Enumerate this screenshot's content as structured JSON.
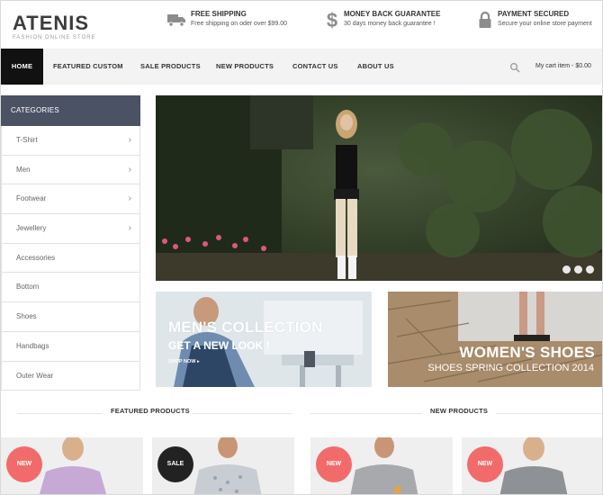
{
  "brand": {
    "name": "ATENIS",
    "tagline": "FASHION ONLINE STORE"
  },
  "features": [
    {
      "icon": "truck-icon",
      "title": "FREE SHIPPING",
      "desc": "Free shipping on oder over $99.00"
    },
    {
      "icon": "dollar-icon",
      "title": "MONEY BACK GUARANTEE",
      "desc": "30 days money back guarantee !"
    },
    {
      "icon": "lock-icon",
      "title": "PAYMENT SECURED",
      "desc": "Secure your online store payment"
    }
  ],
  "nav": {
    "items": [
      "HOME",
      "FEATURED CUSTOM",
      "SALE PRODUCTS",
      "NEW PRODUCTS",
      "CONTACT US",
      "ABOUT US"
    ],
    "cart": "My cart item - $0.00"
  },
  "sidebar": {
    "title": "CATEGORIES",
    "items": [
      {
        "label": "T-Shirt",
        "has_sub": true
      },
      {
        "label": "Men",
        "has_sub": true
      },
      {
        "label": "Footwear",
        "has_sub": true
      },
      {
        "label": "Jewellery",
        "has_sub": true
      },
      {
        "label": "Accessories",
        "has_sub": false
      },
      {
        "label": "Bottom",
        "has_sub": false
      },
      {
        "label": "Shoes",
        "has_sub": false
      },
      {
        "label": "Handbags",
        "has_sub": false
      },
      {
        "label": "Outer Wear",
        "has_sub": false
      }
    ]
  },
  "banners": {
    "men": {
      "title": "MEN'S COLLECTION",
      "subtitle": "GET A NEW LOOK !",
      "cta": "SHOP NOW"
    },
    "women": {
      "title": "WOMEN'S SHOES",
      "subtitle": "SHOES SPRING COLLECTION 2014"
    }
  },
  "sections": {
    "featured": "FEATURED PRODUCTS",
    "new": "NEW PRODUCTS"
  },
  "products": [
    {
      "badge": "NEW",
      "badge_color": "#f26b6b"
    },
    {
      "badge": "SALE",
      "badge_color": "#222222"
    },
    {
      "badge": "NEW",
      "badge_color": "#f26b6b"
    },
    {
      "badge": "NEW",
      "badge_color": "#f26b6b"
    }
  ],
  "colors": {
    "nav_active": "#111111",
    "sidebar_header": "#4a5263",
    "badge_new": "#f26b6b"
  }
}
